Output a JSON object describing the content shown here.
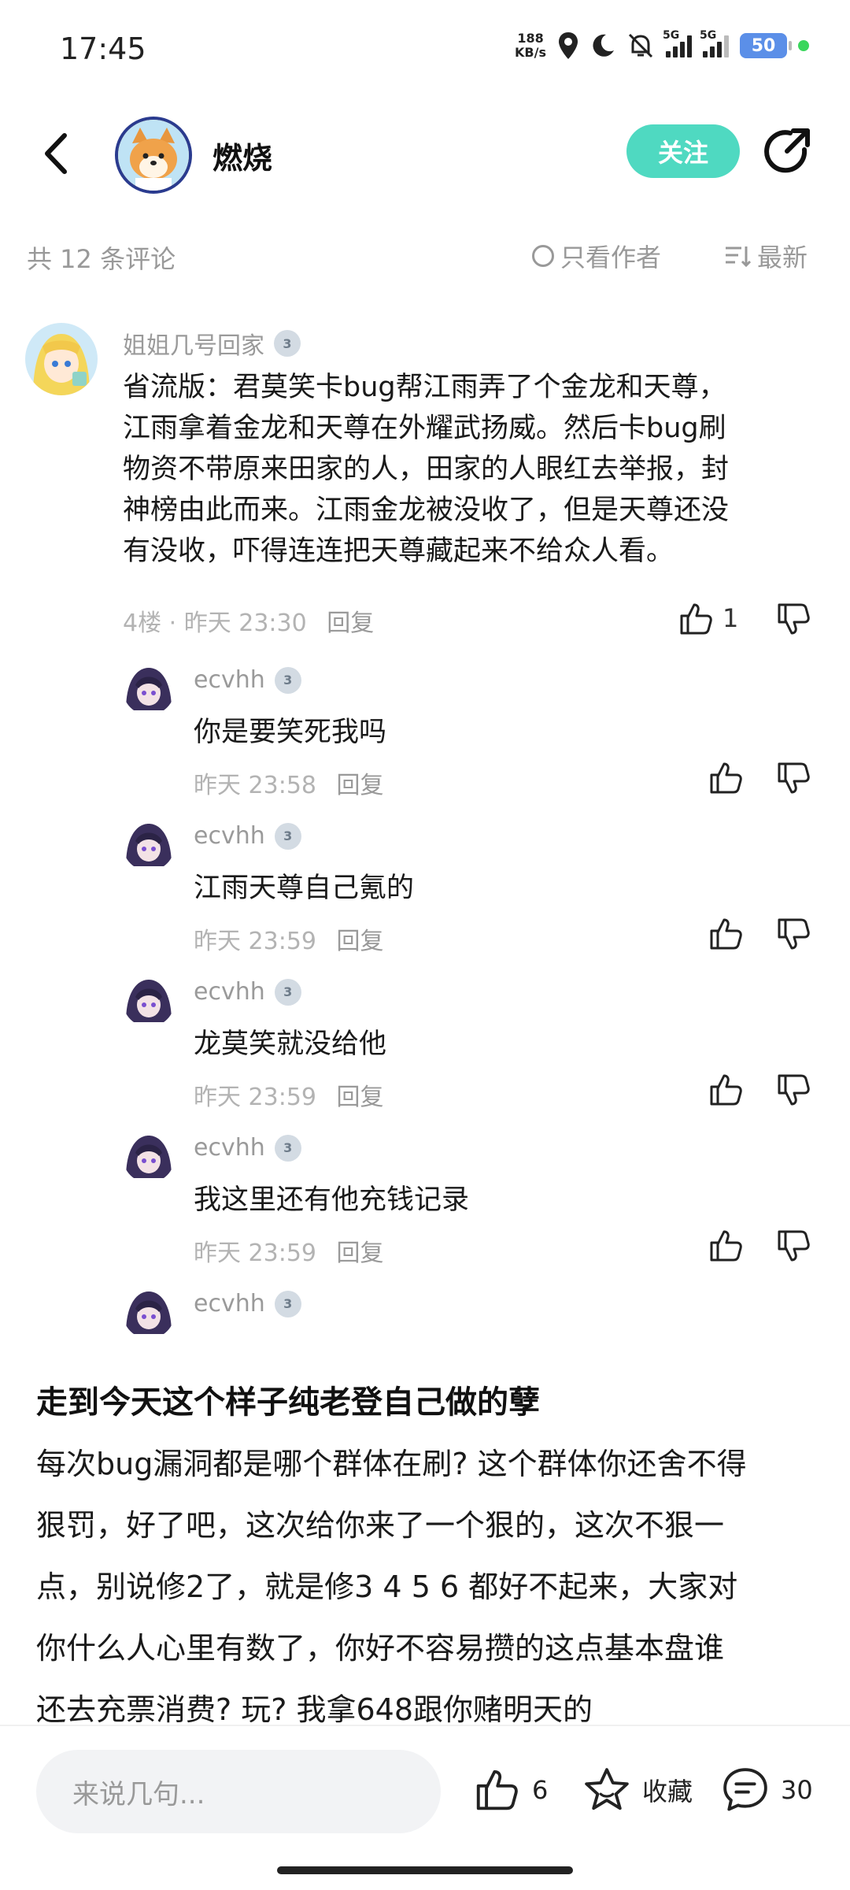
{
  "status_bar": {
    "time": "17:45",
    "net_speed_value": "188",
    "net_speed_unit": "KB/s",
    "sim1_label": "5G",
    "sim2_label": "5G",
    "battery": "50"
  },
  "header": {
    "title": "燃烧",
    "follow_label": "关注"
  },
  "comments_header": {
    "count_label": "共 12 条评论",
    "only_author_label": "只看作者",
    "sort_label": "最新"
  },
  "top_comment": {
    "author": "姐姐几号回家",
    "level": "3",
    "lines": [
      "省流版：君莫笑卡bug帮江雨弄了个金龙和天尊，",
      "江雨拿着金龙和天尊在外耀武扬威。然后卡bug刷",
      "物资不带原来田家的人，田家的人眼红去举报，封",
      "神榜由此而来。江雨金龙被没收了，但是天尊还没",
      "有没收，吓得连连把天尊藏起来不给众人看。"
    ],
    "floor": "4楼",
    "time": "昨天 23:30",
    "reply_label": "回复",
    "likes": "1"
  },
  "replies": [
    {
      "author": "ecvhh",
      "level": "3",
      "text": "你是要笑死我吗",
      "time": "昨天 23:58",
      "reply_label": "回复"
    },
    {
      "author": "ecvhh",
      "level": "3",
      "text": "江雨天尊自己氪的",
      "time": "昨天 23:59",
      "reply_label": "回复"
    },
    {
      "author": "ecvhh",
      "level": "3",
      "text": "龙莫笑就没给他",
      "time": "昨天 23:59",
      "reply_label": "回复"
    },
    {
      "author": "ecvhh",
      "level": "3",
      "text": "我这里还有他充钱记录",
      "time": "昨天 23:59",
      "reply_label": "回复"
    },
    {
      "author": "ecvhh",
      "level": "3"
    }
  ],
  "post": {
    "title": "走到今天这个样子纯老登自己做的孽",
    "lines": [
      "每次bug漏洞都是哪个群体在刷? 这个群体你还舍不得",
      "狠罚，好了吧，这次给你来了一个狠的，这次不狠一",
      "点，别说修2了，就是修3 4  5 6 都好不起来，大家对",
      "你什么人心里有数了，你好不容易攒的这点基本盘谁",
      "还去充票消费? 玩? 我拿648跟你赌明天的"
    ]
  },
  "bottom_bar": {
    "input_placeholder": "来说几句...",
    "like_count": "6",
    "favorite_label": "收藏",
    "comment_count": "30"
  },
  "colors": {
    "accent": "#4fd9c1",
    "muted_text": "#999999",
    "body_text": "#1a1a1a"
  }
}
